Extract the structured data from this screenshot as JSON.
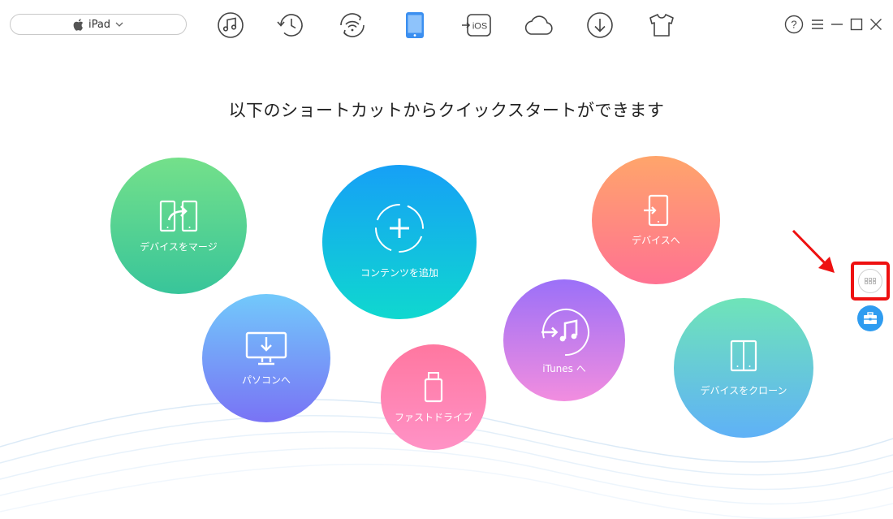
{
  "device_selector": {
    "label": "iPad"
  },
  "toolbar": {
    "items": [
      {
        "name": "music",
        "icon": "music-note-icon"
      },
      {
        "name": "history",
        "icon": "clock-history-icon"
      },
      {
        "name": "wifi",
        "icon": "wifi-sync-icon"
      },
      {
        "name": "device",
        "icon": "ipad-device-icon",
        "active": true
      },
      {
        "name": "ios-mover",
        "icon": "ios-transfer-icon",
        "label": "iOS"
      },
      {
        "name": "cloud",
        "icon": "cloud-icon"
      },
      {
        "name": "download",
        "icon": "download-icon"
      },
      {
        "name": "shirt",
        "icon": "tshirt-icon"
      }
    ]
  },
  "window": {
    "help": "?"
  },
  "title": "以下のショートカットからクイックスタートができます",
  "shortcuts": {
    "merge": "デバイスをマージ",
    "add_content": "コンテンツを追加",
    "to_device": "デバイスへ",
    "to_pc": "パソコンへ",
    "fast_drive": "ファストドライブ",
    "to_itunes": "iTunes へ",
    "clone": "デバイスをクローン"
  },
  "colors": {
    "accent": "#3b8ff0",
    "merge_top": "#6ee087",
    "merge_bottom": "#3cc49a",
    "add_top": "#1aa0f5",
    "add_bottom": "#12d6d0",
    "device_top": "#ff9e6e",
    "device_bottom": "#ff7390",
    "pc_top": "#74c7fb",
    "pc_bottom": "#7a78f5",
    "drive_top": "#ff7aa0",
    "drive_bottom": "#ff8fc4",
    "itunes_top": "#a172f7",
    "itunes_bottom": "#f28be0",
    "clone_top": "#6fe3bb",
    "clone_bottom": "#62b3f6",
    "highlight": "#ee1111"
  }
}
